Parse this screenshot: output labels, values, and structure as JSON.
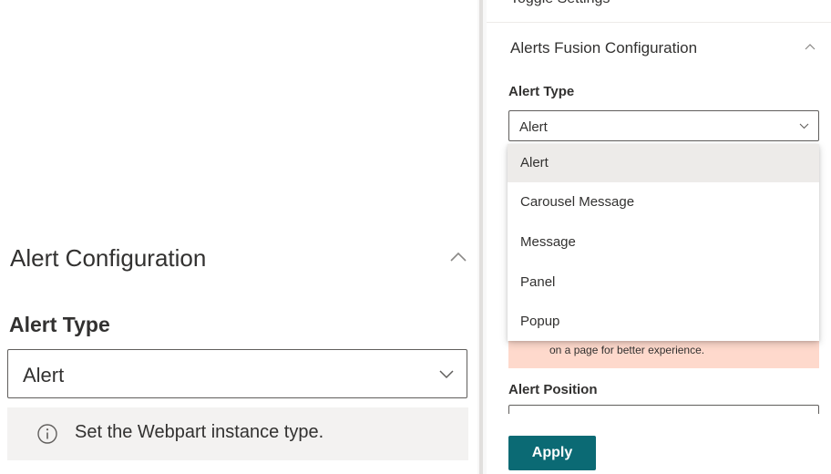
{
  "left": {
    "section_title": "Alert Configuration",
    "field_label": "Alert Type",
    "select_value": "Alert",
    "info_text": "Set the Webpart instance type."
  },
  "right": {
    "previous_section_title": "Toggle Settings",
    "section_title": "Alerts Fusion Configuration",
    "field_label": "Alert Type",
    "select_value": "Alert",
    "dropdown_options": [
      "Alert",
      "Carousel Message",
      "Message",
      "Panel",
      "Popup"
    ],
    "selected_option_index": 0,
    "warning_text": "on a page for better experience.",
    "position_label": "Alert Position",
    "apply_label": "Apply"
  },
  "icons": {
    "collapse": "chevron-up-icon",
    "expand": "chevron-down-icon",
    "info": "info-circle-icon"
  },
  "colors": {
    "accent": "#0b6a74",
    "warning_bg": "#fed9cc",
    "info_bg": "#f3f2f1",
    "selected_option_bg": "#edebe9"
  }
}
